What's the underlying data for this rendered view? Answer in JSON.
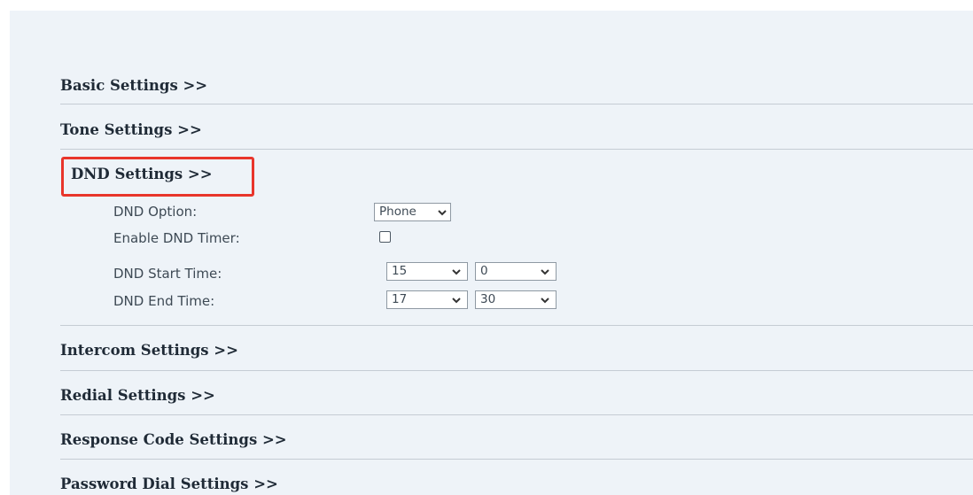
{
  "sections": {
    "basic": "Basic Settings >>",
    "tone": "Tone Settings >>",
    "dnd": "DND Settings >>",
    "intercom": "Intercom Settings >>",
    "redial": "Redial Settings >>",
    "response_code": "Response Code Settings >>",
    "password_dial": "Password Dial Settings >>"
  },
  "dnd": {
    "option_label": "DND Option:",
    "option_value": "Phone",
    "timer_label": "Enable DND Timer:",
    "timer_checked": false,
    "start_label": "DND Start Time:",
    "start_hour": "15",
    "start_minute": "0",
    "end_label": "DND End Time:",
    "end_hour": "17",
    "end_minute": "30"
  },
  "colors": {
    "panel_bg": "#eef3f8",
    "highlight": "#e8352b"
  },
  "icons": {
    "dropdown": "chevron-down-icon"
  }
}
